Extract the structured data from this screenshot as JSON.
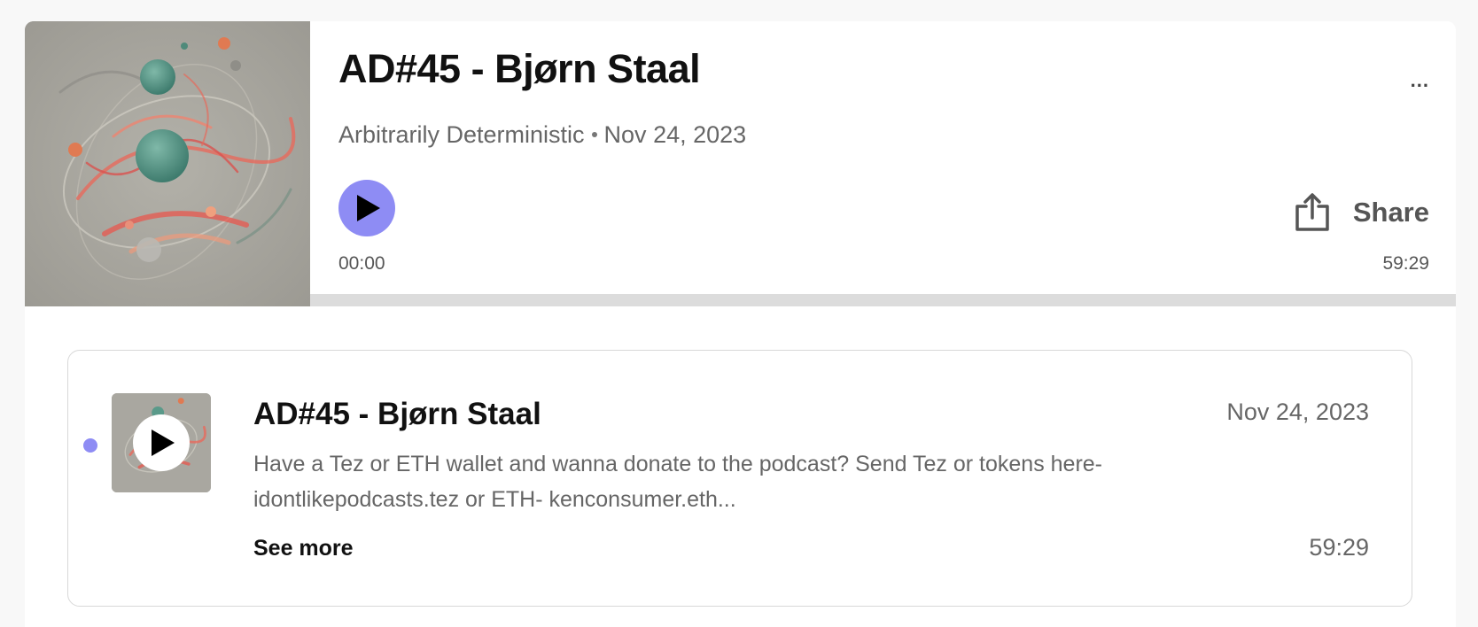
{
  "player": {
    "title": "AD#45 - Bjørn Staal",
    "show_name": "Arbitrarily Deterministic",
    "separator": "•",
    "release_date": "Nov 24, 2023",
    "more_label": "...",
    "current_time": "00:00",
    "total_time": "59:29",
    "share_label": "Share",
    "progress": 0,
    "cover_icon": "artwork-image"
  },
  "episodes": [
    {
      "title": "AD#45 - Bjørn Staal",
      "date": "Nov 24, 2023",
      "description": "Have a Tez or ETH wallet and wanna donate to the podcast? Send Tez or tokens here- idontlikepodcasts.tez or ETH- kenconsumer.eth...",
      "see_more": "See more",
      "duration": "59:29",
      "unplayed": true
    }
  ],
  "colors": {
    "accent": "#8e8cf4",
    "track": "#dcdcdc",
    "text_primary": "#111111",
    "text_secondary": "#666666"
  },
  "icons": {
    "play": "play-icon",
    "share": "share-icon",
    "more": "more-options-icon"
  }
}
